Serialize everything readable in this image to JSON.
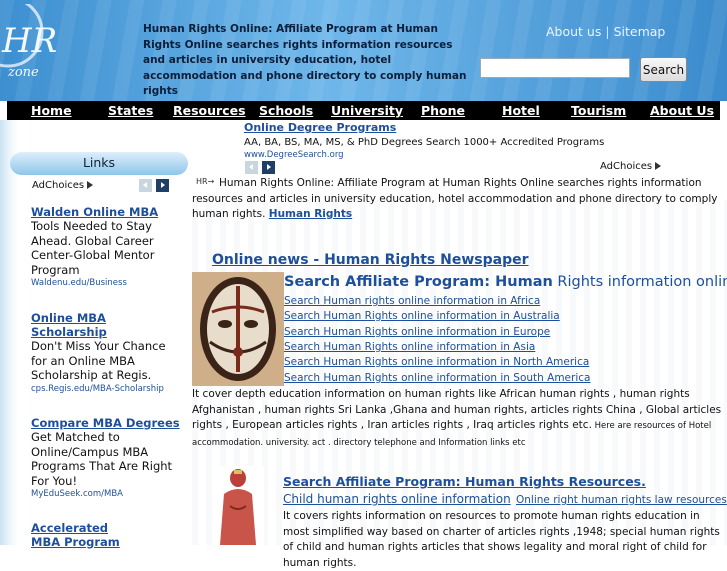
{
  "header": {
    "tagline": "Human Rights Online: Affiliate Program at Human Rights Online searches rights information resources and articles in university education, hotel accommodation and phone directory to comply human rights",
    "about_label": "About us",
    "sitemap_label": "Sitemap",
    "search_value": "",
    "search_button": "Search",
    "logo_text": "HR",
    "logo_sub": "zone"
  },
  "nav": {
    "items": [
      "Home",
      "States",
      "Resources",
      "Schools",
      "University",
      "Phone",
      "Hotel",
      "Tourism",
      "About Us"
    ]
  },
  "sidebar": {
    "heading": "Links",
    "adchoices": "AdChoices",
    "ads": [
      {
        "title": "Walden Online MBA",
        "desc": "Tools Needed to Stay Ahead. Global Career Center-Global Mentor Program",
        "url": "Waldenu.edu/Business"
      },
      {
        "title": "Online MBA Scholarship",
        "desc": "Don't Miss Your Chance for an Online MBA Scholarship at Regis.",
        "url": "cps.Regis.edu/MBA-Scholarship"
      },
      {
        "title": "Compare MBA Degrees",
        "desc": "Get Matched to Online/Campus MBA Programs That Are Right For You!",
        "url": "MyEduSeek.com/MBA"
      },
      {
        "title": "Accelerated MBA Program",
        "desc": "",
        "url": ""
      }
    ]
  },
  "top_ad": {
    "title": "Online Degree Programs",
    "desc": "AA, BA, BS, MA, MS, & PhD Degrees Search 1000+ Accredited Programs",
    "url": "www.DegreeSearch.org",
    "adchoices": "AdChoices"
  },
  "main": {
    "hr_mini": "HR→",
    "intro": "Human Rights Online: Affiliate Program at Human Rights Online searches rights information resources and articles in university education, hotel accommodation and phone directory to comply human rights.",
    "intro_link": "Human Rights",
    "news_heading": "Online news - Human Rights Newspaper",
    "aff1_part1": "Search Affiliate Program: Human",
    "aff1_part2": " Rights information online",
    "region_links": [
      "Search Human rights online information in Africa",
      "Search Human Rights online information in Australia",
      "Search Human Rights online information in Europe",
      "Search Human Rights online information in Asia",
      "Search Human Rights online information in North America",
      "Search Human Rights online information in South America"
    ],
    "body1": "It cover depth education information on human rights like African human rights  , human rights Afghanistan , human rights Sri Lanka ,Ghana and human rights, articles rights China , Global articles rights , European articles rights , Iran articles rights , Iraq articles rights etc.",
    "body1_small": " Here are resources of Hotel accommodation. university. act . directory telephone and Information links etc",
    "aff2": "Search Affiliate Program:  Human Rights Resources.",
    "child_link": "Child human rights online information",
    "law_link": "Online right human rights law resources",
    "body2": "It covers rights information on resources  to promote human rights education in most simplified way based on charter of articles rights ,1948; special human rights of child and human rights articles that shows legality and moral right of child for human rights."
  }
}
